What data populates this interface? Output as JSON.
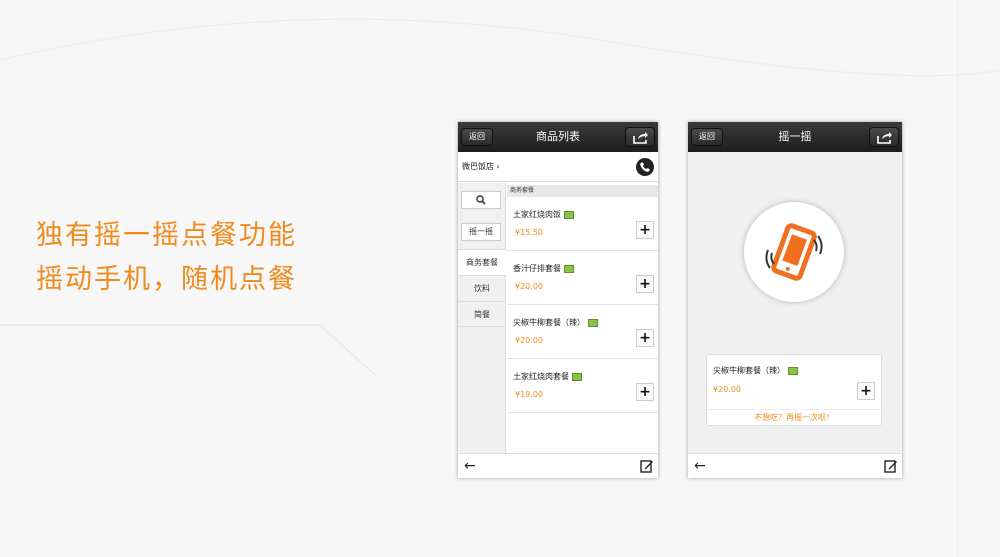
{
  "headline": {
    "line1": "独有摇一摇点餐功能",
    "line2": "摇动手机，随机点餐",
    "color": "#f08a1c"
  },
  "screen1": {
    "back_label": "返回",
    "title": "商品列表",
    "shop_name": "微巴饭店 ›",
    "sidebar": {
      "shake_label": "摇一摇",
      "categories": [
        "商务套餐",
        "饮料",
        "简餐"
      ]
    },
    "category_header": "商务套餐",
    "products": [
      {
        "name": "土家红烧肉饭",
        "price": "¥15.50",
        "old_price": ""
      },
      {
        "name": "香汁仔排套餐",
        "price": "¥20.00",
        "old_price": ""
      },
      {
        "name": "尖椒牛柳套餐（辣）",
        "price": "¥20.00",
        "old_price": ""
      },
      {
        "name": "土家红烧肉套餐",
        "price": "¥19.00",
        "old_price": ""
      }
    ],
    "add_label": "+",
    "back_arrow": "←"
  },
  "screen2": {
    "back_label": "返回",
    "title": "摇一摇",
    "result": {
      "name": "尖椒牛柳套餐（辣）",
      "price": "¥20.00",
      "add_label": "+",
      "retry": "不想吃？再摇一次呗！"
    },
    "back_arrow": "←"
  },
  "icons": {
    "share": "share-icon",
    "search": "search-icon",
    "phone": "phone-call-icon",
    "edit": "edit-icon",
    "image": "image-icon",
    "shake": "shaking-phone-icon"
  }
}
